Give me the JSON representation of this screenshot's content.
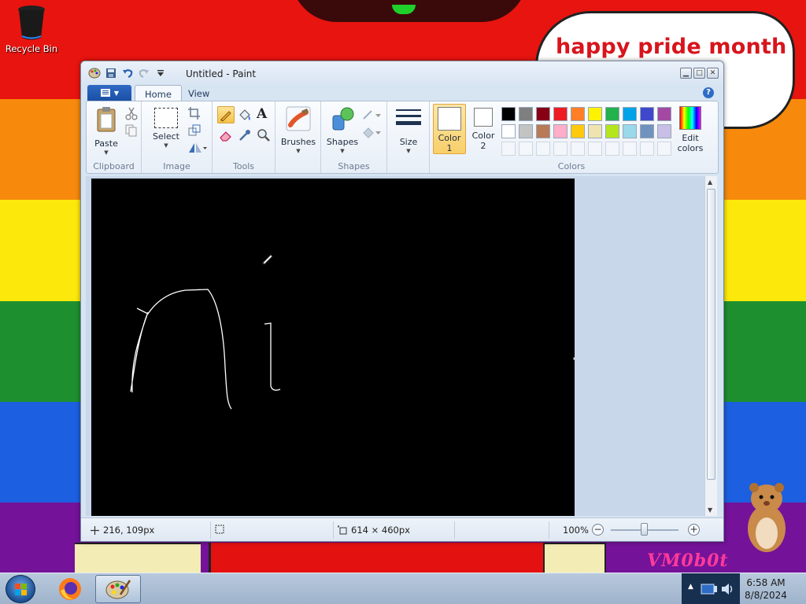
{
  "desktop": {
    "speech_bubble": "happy pride month",
    "watermark": "VM0b0t",
    "icons": [
      {
        "label": "Recycle Bin",
        "icon": "recycle-bin-icon"
      }
    ]
  },
  "window": {
    "title": "Untitled - Paint",
    "tabs": [
      {
        "label": "Home",
        "active": true
      },
      {
        "label": "View",
        "active": false
      }
    ],
    "ribbon": {
      "clipboard": {
        "label": "Clipboard",
        "paste": "Paste"
      },
      "image": {
        "label": "Image",
        "select": "Select"
      },
      "tools": {
        "label": "Tools",
        "selected": "pencil"
      },
      "brushes": {
        "label": "Brushes"
      },
      "shapes": {
        "label": "Shapes",
        "button": "Shapes"
      },
      "size": {
        "label": "Size"
      },
      "colors": {
        "label": "Colors",
        "color1_line1": "Color",
        "color1_line2": "1",
        "color2_line1": "Color",
        "color2_line2": "2",
        "edit_line1": "Edit",
        "edit_line2": "colors",
        "color1_value": "#ffffff",
        "color2_value": "#ffffff",
        "palette_row1": [
          "#000000",
          "#7f7f7f",
          "#880015",
          "#ed1c24",
          "#ff7f27",
          "#fff200",
          "#22b14c",
          "#00a2e8",
          "#3f48cc",
          "#a349a4"
        ],
        "palette_row2": [
          "#ffffff",
          "#c3c3c3",
          "#b97a57",
          "#ffaec9",
          "#ffc90e",
          "#efe4b0",
          "#b5e61d",
          "#99d9ea",
          "#7092be",
          "#c8bfe7"
        ]
      }
    },
    "status": {
      "cursor_pos": "216, 109px",
      "canvas_size": "614 × 460px",
      "zoom": "100%"
    }
  },
  "taskbar": {
    "time": "6:58 AM",
    "date": "8/8/2024",
    "apps": [
      {
        "name": "firefox",
        "icon": "firefox-icon"
      },
      {
        "name": "paint",
        "icon": "paint-icon",
        "active": true
      }
    ]
  }
}
